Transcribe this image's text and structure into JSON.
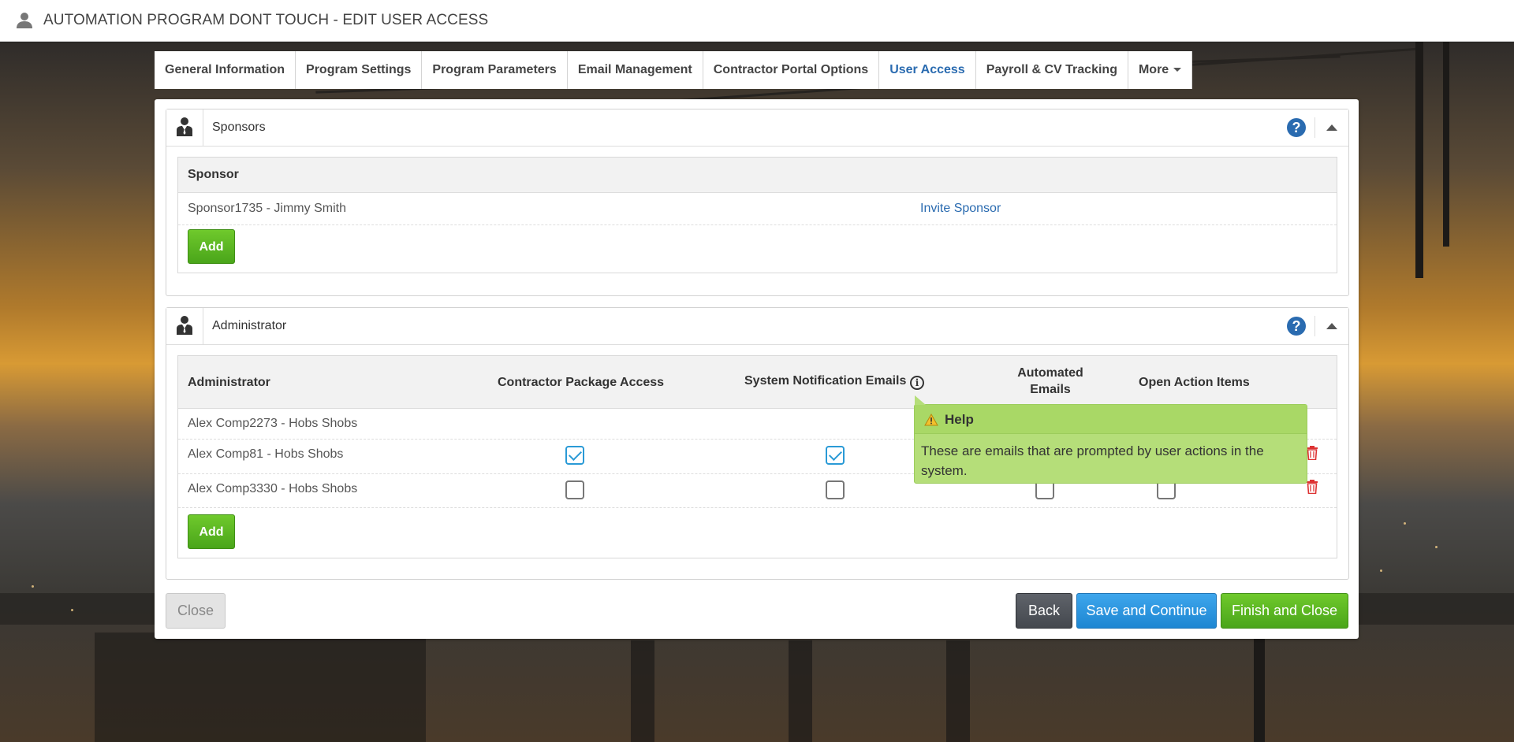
{
  "header": {
    "title": "AUTOMATION PROGRAM DONT TOUCH - EDIT USER ACCESS"
  },
  "tabs": [
    {
      "label": "General Information"
    },
    {
      "label": "Program Settings"
    },
    {
      "label": "Program Parameters"
    },
    {
      "label": "Email Management"
    },
    {
      "label": "Contractor Portal Options"
    },
    {
      "label": "User Access"
    },
    {
      "label": "Payroll & CV Tracking"
    },
    {
      "label": "More"
    }
  ],
  "sponsors": {
    "title": "Sponsors",
    "column": "Sponsor",
    "rows": [
      {
        "name": "Sponsor1735 - Jimmy Smith",
        "action": "Invite Sponsor"
      }
    ],
    "add_label": "Add"
  },
  "administrator": {
    "title": "Administrator",
    "columns": {
      "name": "Administrator",
      "package": "Contractor Package Access",
      "system": "System Notification Emails",
      "automated_1": "Automated",
      "automated_2": "Emails",
      "open": "Open Action Items"
    },
    "rows": [
      {
        "name": "Alex Comp2273 - Hobs Shobs"
      },
      {
        "name": "Alex Comp81 - Hobs Shobs",
        "package": true,
        "system": true
      },
      {
        "name": "Alex Comp3330 - Hobs Shobs",
        "package": false,
        "system": false,
        "automated": false,
        "open": false
      }
    ],
    "add_label": "Add"
  },
  "tooltip": {
    "title": "Help",
    "body": "These are emails that are prompted by user actions in the system."
  },
  "footer": {
    "close": "Close",
    "back": "Back",
    "save": "Save and Continue",
    "finish": "Finish and Close"
  }
}
